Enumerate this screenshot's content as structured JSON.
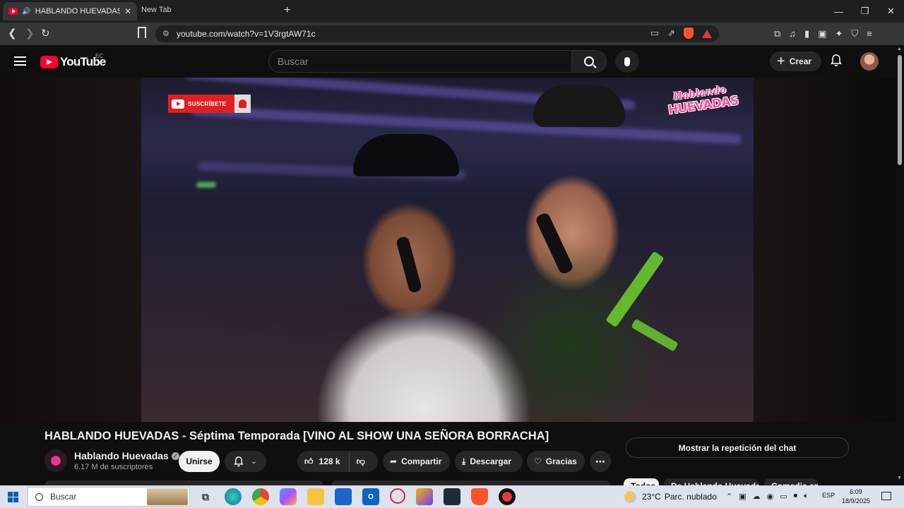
{
  "browser": {
    "active_tab_title": "HABLANDO HUEVADAS - Sépt",
    "inactive_tab_title": "New Tab",
    "url": "youtube.com/watch?v=1V3rgtAW71c",
    "new_tab_icon": "plus-icon",
    "window_controls": [
      "minimize-icon",
      "restore-icon",
      "close-icon"
    ]
  },
  "youtube": {
    "logo_text": "YouTube",
    "region_code": "EC",
    "search_placeholder": "Buscar",
    "create_label": "Crear",
    "brand_color": "#ff0033"
  },
  "video_overlay": {
    "subscribe_text": "SUSCRÍBETE",
    "brand_top": "Hablando",
    "brand_bottom": "HUEVADAS"
  },
  "video": {
    "title": "HABLANDO HUEVADAS - Séptima Temporada [VINO AL SHOW UNA SEÑORA BORRACHA]",
    "channel_name": "Hablando Huevadas",
    "subscribers": "6.17 M de suscriptores",
    "join_label": "Unirse",
    "like_count": "128 k",
    "share_label": "Compartir",
    "download_label": "Descargar",
    "thanks_label": "Gracias",
    "chat_replay_label": "Mostrar la repetición del chat",
    "chips": [
      "Todos",
      "De Hablando Huevadas",
      "Comedia en"
    ]
  },
  "taskbar": {
    "search_placeholder": "Buscar",
    "temperature": "23°C",
    "weather": "Parc. nublado",
    "language": "ESP",
    "time": "6:09",
    "date": "18/9/2025",
    "accent_color": "#0a5fb4"
  }
}
